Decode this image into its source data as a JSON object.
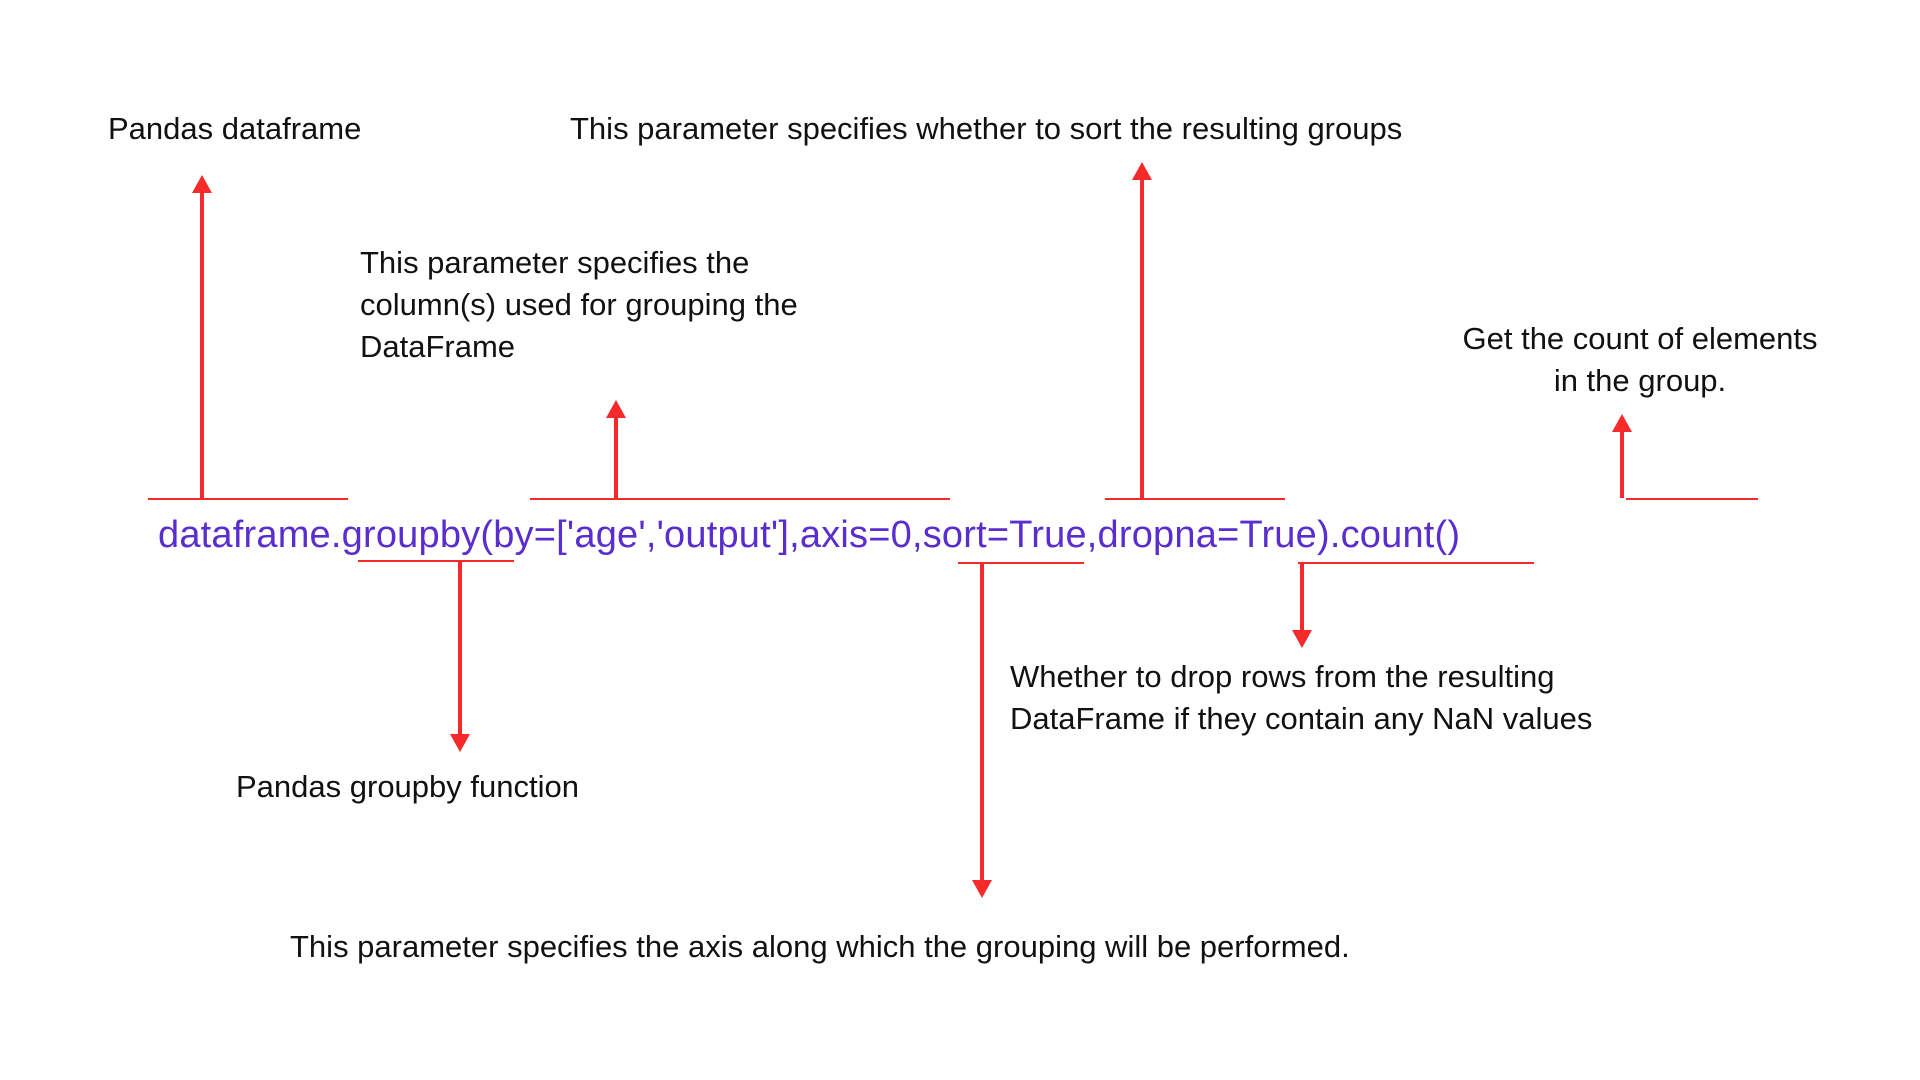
{
  "labels": {
    "dataframe": "Pandas dataframe",
    "by_param": "This parameter specifies the\ncolumn(s) used for grouping the\nDataFrame",
    "sort_param": "This parameter specifies whether to sort the resulting groups",
    "count_method": "Get the count of elements\nin the group.",
    "groupby_fn": "Pandas groupby function",
    "dropna_param": "Whether to drop rows from the resulting\nDataFrame if they contain any NaN values",
    "axis_param": "This parameter specifies the axis along which the grouping will be performed."
  },
  "code": "dataframe.groupby(by=['age','output'],axis=0,sort=True,dropna=True).count()"
}
